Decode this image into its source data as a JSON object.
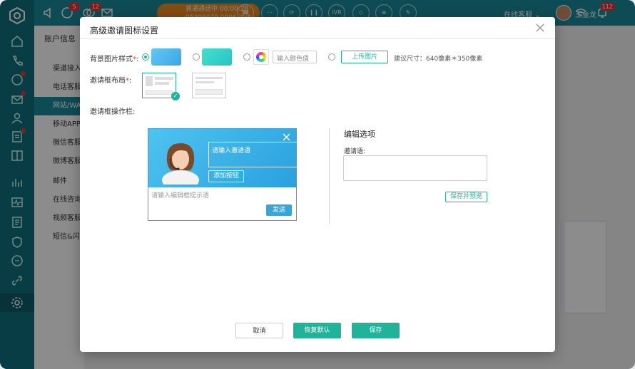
{
  "topbar": {
    "call_status": "普通通话中 00:00:28",
    "call_number": "05306079 0906 达达",
    "badge_messages": "5",
    "badge_chat": "12",
    "badge_notify": "112",
    "ivr_label": "IVR",
    "agent_status": "在线客服",
    "user_name": "王金龙"
  },
  "subnav": {
    "title": "账户信息",
    "items": [
      "渠道接入",
      "电话客服",
      "网站/WAP",
      "移动APP",
      "微信客服",
      "微博客服",
      "邮件",
      "在线咨询",
      "视频客服",
      "短信&闪信"
    ]
  },
  "modal": {
    "title": "高级邀请图标设置",
    "bg_style_label": "背景图片样式",
    "required_mark": "*",
    "color_placeholder": "输入颜色值",
    "upload_label": "上传图片",
    "size_hint": "建议尺寸：640像素＊350像素",
    "layout_label": "邀请框布局",
    "toolbar_label": "邀请框操作栏:",
    "preview": {
      "invite_placeholder": "请输入邀请语",
      "add_button": "添加按钮",
      "input_hint": "请输入编辑框提示语",
      "send": "发送"
    },
    "edit": {
      "title": "编辑选项",
      "invite_label": "邀请语:",
      "save_preview": "保存并预览"
    },
    "footer": {
      "cancel": "取消",
      "reset": "恢复默认",
      "save": "保存"
    },
    "colors": {
      "swatch1": "#4ab8ef",
      "swatch2": "#35d4c8",
      "accent": "#20b39a"
    }
  }
}
